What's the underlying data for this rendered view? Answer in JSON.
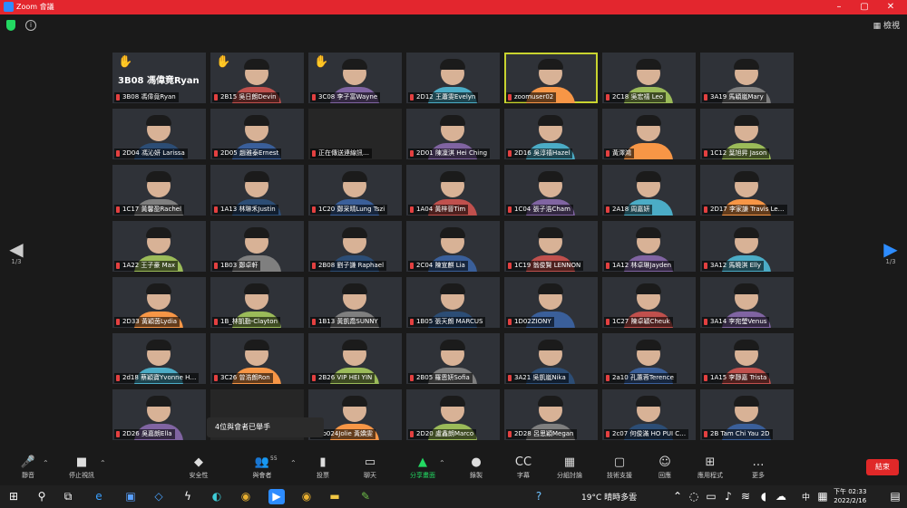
{
  "window": {
    "title": "Zoom 會議",
    "colors": {
      "titlebar": "#e3262e",
      "accent": "#2d8cff",
      "green": "#23d962",
      "end": "#e02828"
    }
  },
  "topbar": {
    "view_label": "檢視",
    "security_icon": "shield-icon"
  },
  "pager": {
    "left": "1/3",
    "right": "1/3"
  },
  "participants": [
    {
      "name": "3B08 馮偉竟Ryan",
      "big": "3B08 馮偉竟Ryan",
      "hand": "✋"
    },
    {
      "name": "2B15 吳日朗Devin",
      "hand": "✋"
    },
    {
      "name": "3C08 李子富Wayne",
      "hand": "✋"
    },
    {
      "name": "2D12 王蕭雯Evelyn"
    },
    {
      "name": "zoomuser02",
      "active": true
    },
    {
      "name": "2C18 吳宏禧 Leo"
    },
    {
      "name": "3A19 馬穎嵐Mary"
    },
    {
      "name": "2D04 馮沁妍 Larissa"
    },
    {
      "name": "2D05 趙雅泰Ernest"
    },
    {
      "name": "正在傳送連線訊…",
      "blank": true
    },
    {
      "name": "2D01 陳凜淇 Hei Ching"
    },
    {
      "name": "2D16 吳淳禧Hazel"
    },
    {
      "name": "黃澤鴻"
    },
    {
      "name": "1C12 葉旭昇 Jason"
    },
    {
      "name": "1C17 黃馨盈Rachel"
    },
    {
      "name": "1A13 林琳禾Justin"
    },
    {
      "name": "1C20 鄭采晴Lung Tszi"
    },
    {
      "name": "1A04 黃梓晉Tim"
    },
    {
      "name": "1C04 張子浩Cham"
    },
    {
      "name": "2A18 周嘉妍"
    },
    {
      "name": "2D17 李家謙 Travis Le…"
    },
    {
      "name": "1A22 王子豪 Max"
    },
    {
      "name": "1B03 鄭卓軒"
    },
    {
      "name": "2B08 劉子謙 Raphael"
    },
    {
      "name": "2C04 陳宣麒 Lia"
    },
    {
      "name": "1C19 翁俊賢 LENNON"
    },
    {
      "name": "1A12 林卓琳Jayden"
    },
    {
      "name": "3A12 馬曉淇 Elly"
    },
    {
      "name": "2D33 黃穎茵Lydia"
    },
    {
      "name": "1B_林凱勤-Clayton"
    },
    {
      "name": "1B13 黃凱喬SUNNY"
    },
    {
      "name": "1B05 張天朗 MARCUS"
    },
    {
      "name": "1D02ZIONY"
    },
    {
      "name": "1C27 陳卓穎Cheuk"
    },
    {
      "name": "3A14 李宛瑩Venus"
    },
    {
      "name": "2d18 蔡穎寶Yvonne H…"
    },
    {
      "name": "3C26 曾浩朗Ron"
    },
    {
      "name": "2B26 VIP HEI YIN"
    },
    {
      "name": "2B05 羅恩妍Sofia"
    },
    {
      "name": "3A21 吳凱嵐Nika"
    },
    {
      "name": "2a10 孔蕙蓉Terence"
    },
    {
      "name": "1A15 李靜嘉 Trista"
    },
    {
      "name": "2D26 吳嘉朗Ella"
    },
    {
      "name": "",
      "blank": true
    },
    {
      "name": "1b024Jolie 黃嬌雯"
    },
    {
      "name": "2D20 盧鑫朗Marco"
    },
    {
      "name": "2D28 呂思穎Megan"
    },
    {
      "name": "2c07 何俊滿 HO PUI C…"
    },
    {
      "name": "2B Tam Chi Yau 2D"
    }
  ],
  "toast": "4位與會者已舉手",
  "toolbar": {
    "participant_count": "55",
    "buttons": [
      {
        "id": "mute",
        "label": "靜音",
        "icon": "🎤"
      },
      {
        "id": "video",
        "label": "停止視訊",
        "icon": "■"
      },
      {
        "id": "security",
        "label": "安全性",
        "icon": "◆"
      },
      {
        "id": "participants",
        "label": "與會者",
        "icon": "👥"
      },
      {
        "id": "poll",
        "label": "投票",
        "icon": "▮"
      },
      {
        "id": "chat",
        "label": "聊天",
        "icon": "▭"
      },
      {
        "id": "share",
        "label": "分享畫面",
        "icon": "▲"
      },
      {
        "id": "record",
        "label": "錄製",
        "icon": "●"
      },
      {
        "id": "cc",
        "label": "字幕",
        "icon": "CC"
      },
      {
        "id": "breakout",
        "label": "分組討論",
        "icon": "▦"
      },
      {
        "id": "support",
        "label": "技術支援",
        "icon": "▢"
      },
      {
        "id": "reactions",
        "label": "回應",
        "icon": "☺"
      },
      {
        "id": "apps",
        "label": "應用程式",
        "icon": "⊞"
      },
      {
        "id": "more",
        "label": "更多",
        "icon": "…"
      }
    ],
    "end_label": "結束"
  },
  "taskbar": {
    "weather": "19°C 晴時多雲",
    "input_method": "中",
    "time": "下午 02:33",
    "date": "2022/2/16"
  }
}
